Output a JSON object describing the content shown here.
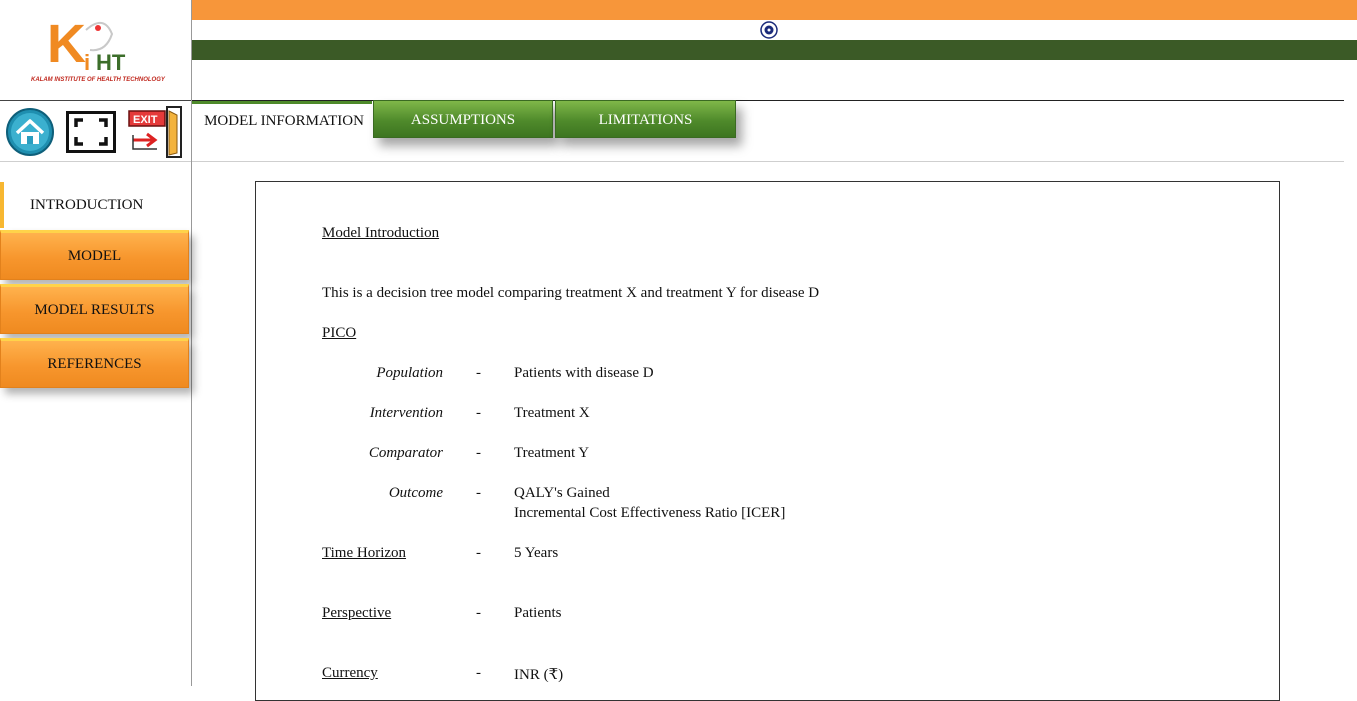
{
  "logo": {
    "mark": "KiHT",
    "tagline": "KALAM INSTITUTE OF HEALTH TECHNOLOGY"
  },
  "toolbar": {
    "home": "home-icon",
    "fullscreen": "fullscreen-icon",
    "exit_label": "EXIT"
  },
  "tabs": {
    "current": "MODEL INFORMATION",
    "items": [
      "ASSUMPTIONS",
      "LIMITATIONS"
    ]
  },
  "nav": {
    "current": "INTRODUCTION",
    "items": [
      "MODEL",
      "MODEL RESULTS",
      "REFERENCES"
    ]
  },
  "content": {
    "heading": "Model Introduction",
    "intro": "This is a decision tree model comparing treatment X and treatment Y for disease D",
    "pico_heading": "PICO",
    "dash": "-",
    "pico": [
      {
        "label": "Population",
        "value": "Patients with disease D"
      },
      {
        "label": "Intervention",
        "value": "Treatment X"
      },
      {
        "label": "Comparator",
        "value": "Treatment Y"
      },
      {
        "label": "Outcome",
        "value": "QALY's Gained",
        "value2": "Incremental Cost Effectiveness Ratio [ICER]"
      }
    ],
    "time_horizon": {
      "label": "Time Horizon",
      "value": "5 Years"
    },
    "perspective": {
      "label": "Perspective",
      "value": "Patients"
    },
    "currency": {
      "label": "Currency",
      "value": "INR (₹)"
    }
  },
  "colors": {
    "saffron": "#f7963a",
    "green": "#3b5a26",
    "tab_green": "#4f8a2b",
    "nav_orange": "#f7962d"
  }
}
